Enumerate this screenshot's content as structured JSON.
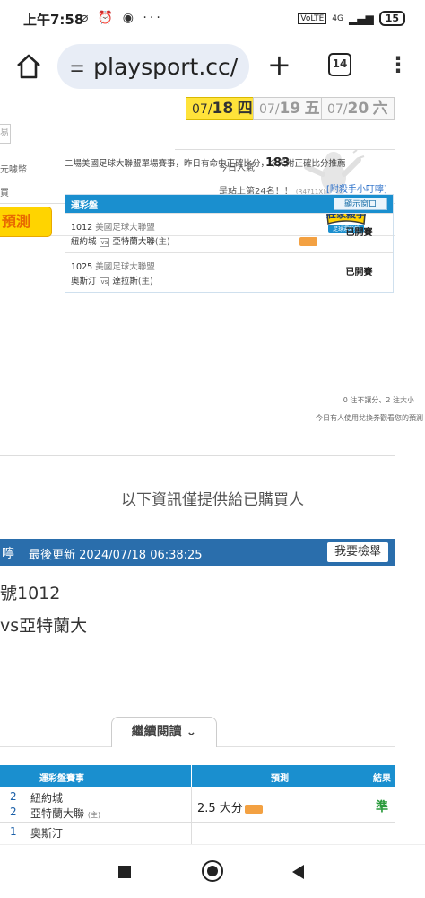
{
  "status_bar": {
    "time": "上午7:58",
    "icons": "⌀ ⏰ ◉ ···",
    "network": "4G",
    "battery": "15"
  },
  "browser": {
    "url": "playsport.cc/",
    "tab_count": "14"
  },
  "date_tabs": [
    {
      "month": "07/",
      "day": "18",
      "weekday": "四"
    },
    {
      "month": "07/",
      "day": "19",
      "weekday": "五"
    },
    {
      "month": "07/",
      "day": "20",
      "weekday": "六"
    }
  ],
  "side_stub": "易",
  "popularity": {
    "label": "今日人氣",
    "value": "183",
    "rank_text": "是站上第24名！！",
    "rank_id": "(R4711X)"
  },
  "badge": {
    "line1": "莊家殺手",
    "line2": "足球運彩盤"
  },
  "sidebar_labels": [
    "元噱幣",
    "買"
  ],
  "predict_button": "預測",
  "notice": "二場美國足球大聯盟單場賽事，昨日有命中正確比分，今天附正確比分推薦",
  "tips_link": "[附殺手小叮嚀]",
  "lottery": {
    "header": "運彩盤",
    "show_window": "顯示窗口",
    "rows": [
      {
        "game_no": "1012",
        "league": "美國足球大聯盟",
        "away": "紐約城",
        "vs": "vs",
        "home": "亞特蘭大聯",
        "host": "(主)",
        "status": "已開賽"
      },
      {
        "game_no": "1025",
        "league": "美國足球大聯盟",
        "away": "奧斯汀",
        "vs": "vs",
        "home": "達拉斯",
        "host": "(主)",
        "status": "已開賽"
      }
    ]
  },
  "footnotes": [
    "0 注不讓分、2 注大小",
    "今日有人使用兌換券觀看您的預測"
  ],
  "buyer_notice": "以下資訊僅提供給已購買人",
  "update": {
    "prefix": "嚀",
    "time": "最後更新 2024/07/18 06:38:25",
    "report_button": "我要檢舉"
  },
  "article": {
    "line1": "號1012",
    "line2": "vs亞特蘭大"
  },
  "read_more": "繼續閱讀 ⌄",
  "result_table": {
    "headers": {
      "game": "運彩盤賽事",
      "prediction": "預測",
      "result": "結果"
    },
    "rows": [
      {
        "num1": "2",
        "team1": "紐約城",
        "num2": "2",
        "team2": "亞特蘭大聯",
        "host": "(主)",
        "prediction": "2.5 大分",
        "result": "準"
      },
      {
        "num1": "1",
        "team1": "奧斯汀",
        "num2": "",
        "team2": "",
        "host": "",
        "prediction": "",
        "result": ""
      }
    ]
  }
}
